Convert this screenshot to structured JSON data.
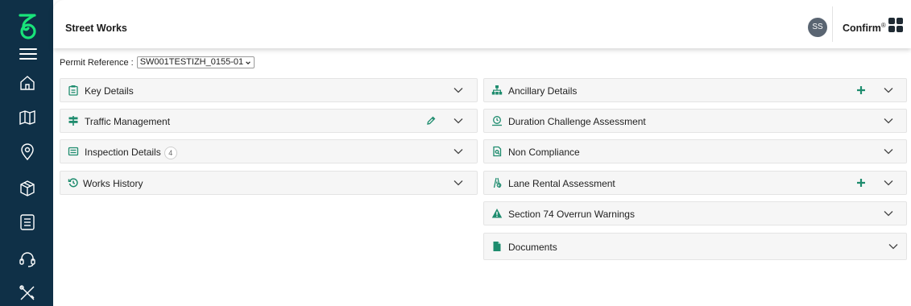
{
  "header": {
    "title": "Street Works",
    "avatar_initials": "SS",
    "brand": "Confirm",
    "brand_mark": "®"
  },
  "permit": {
    "label": "Permit Reference :",
    "value": "SW001TESTIZH_0155-01"
  },
  "left_panels": [
    {
      "label": "Key Details",
      "icon": "clipboard-icon"
    },
    {
      "label": "Traffic Management",
      "icon": "signpost-icon"
    },
    {
      "label": "Inspection Details",
      "icon": "list-icon",
      "count": "4"
    },
    {
      "label": "Works History",
      "icon": "history-icon"
    }
  ],
  "right_panels": [
    {
      "label": "Ancillary Details",
      "icon": "sitemap-icon"
    },
    {
      "label": "Duration Challenge Assessment",
      "icon": "timer-icon"
    },
    {
      "label": "Non Compliance",
      "icon": "report-icon"
    },
    {
      "label": "Lane Rental Assessment",
      "icon": "lane-icon"
    },
    {
      "label": "Section 74 Overrun Warnings",
      "icon": "warning-icon"
    },
    {
      "label": "Documents",
      "icon": "document-icon"
    }
  ],
  "colors": {
    "sidebar": "#0f3047",
    "accent": "#1e8c6e",
    "panel_bg": "#f6f6f6",
    "logo": "#19e37a"
  }
}
